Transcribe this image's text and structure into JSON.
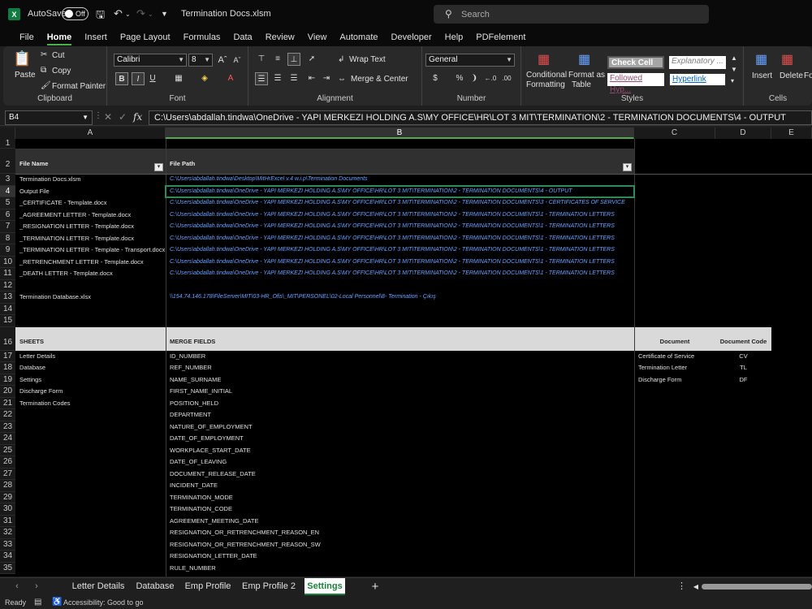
{
  "title_bar": {
    "autosave_label": "AutoSave",
    "autosave_state": "Off",
    "document_title": "Termination Docs.xlsm",
    "search_placeholder": "Search"
  },
  "menu": [
    "File",
    "Home",
    "Insert",
    "Page Layout",
    "Formulas",
    "Data",
    "Review",
    "View",
    "Automate",
    "Developer",
    "Help",
    "PDFelement"
  ],
  "ribbon": {
    "clipboard": {
      "paste": "Paste",
      "cut": "Cut",
      "copy": "Copy",
      "format_painter": "Format Painter",
      "label": "Clipboard"
    },
    "font": {
      "name": "Calibri",
      "size": "8",
      "label": "Font"
    },
    "alignment": {
      "wrap_text": "Wrap Text",
      "merge_center": "Merge & Center",
      "label": "Alignment"
    },
    "number": {
      "format": "General",
      "label": "Number"
    },
    "styles": {
      "conditional": "Conditional",
      "formatting": "Formatting",
      "format_as": "Format as",
      "table": "Table",
      "check_cell": "Check Cell",
      "explanatory": "Explanatory ...",
      "followed": "Followed Hyp...",
      "hyperlink": "Hyperlink",
      "label": "Styles"
    },
    "cells": {
      "insert": "Insert",
      "delete": "Delete",
      "format": "For",
      "label": "Cells"
    }
  },
  "formula_bar": {
    "name_box": "B4",
    "value": "C:\\Users\\abdallah.tindwa\\OneDrive - YAPI MERKEZI HOLDING A.S\\MY OFFICE\\HR\\LOT 3 MIT\\TERMINATION\\2 - TERMINATION DOCUMENTS\\4 - OUTPUT"
  },
  "columns": [
    "A",
    "B",
    "C",
    "D",
    "E"
  ],
  "rows": [
    "1",
    "2",
    "3",
    "4",
    "5",
    "6",
    "7",
    "8",
    "9",
    "10",
    "11",
    "12",
    "13",
    "14",
    "15",
    "16",
    "17",
    "18",
    "19",
    "20",
    "21",
    "22",
    "23",
    "24",
    "25",
    "26",
    "27",
    "28",
    "29",
    "30",
    "31",
    "32",
    "33",
    "34",
    "35"
  ],
  "table1": {
    "header_a": "File Name",
    "header_b": "File Path",
    "names": [
      "Termination Docs.xlsm",
      "Output File",
      "_CERTIFICATE - Template.docx",
      "_AGREEMENT LETTER - Template.docx",
      "_RESIGNATION LETTER - Template.docx",
      "_TERMINATION LETTER - Template.docx",
      "_TERMINATION LETTER - Template - Transport.docx",
      "_RETRENCHMENT LETTER - Template.docx",
      "_DEATH LETTER - Template.docx"
    ],
    "paths": [
      "C:\\Users\\abdallah.tindwa\\Desktop\\MitHrExcel v.4 w.i.p\\Termination Documents",
      "C:\\Users\\abdallah.tindwa\\OneDrive - YAPI MERKEZI HOLDING A.S\\MY OFFICE\\HR\\LOT 3 MIT\\TERMINATION\\2 - TERMINATION DOCUMENTS\\4 - OUTPUT",
      "C:\\Users\\abdallah.tindwa\\OneDrive - YAPI MERKEZI HOLDING A.S\\MY OFFICE\\HR\\LOT 3 MIT\\TERMINATION\\2 - TERMINATION DOCUMENTS\\3 - CERTIFICATES OF SERVICE",
      "C:\\Users\\abdallah.tindwa\\OneDrive - YAPI MERKEZI HOLDING A.S\\MY OFFICE\\HR\\LOT 3 MIT\\TERMINATION\\2 - TERMINATION DOCUMENTS\\1 - TERMINATION LETTERS",
      "C:\\Users\\abdallah.tindwa\\OneDrive - YAPI MERKEZI HOLDING A.S\\MY OFFICE\\HR\\LOT 3 MIT\\TERMINATION\\2 - TERMINATION DOCUMENTS\\1 - TERMINATION LETTERS",
      "C:\\Users\\abdallah.tindwa\\OneDrive - YAPI MERKEZI HOLDING A.S\\MY OFFICE\\HR\\LOT 3 MIT\\TERMINATION\\2 - TERMINATION DOCUMENTS\\1 - TERMINATION LETTERS",
      "C:\\Users\\abdallah.tindwa\\OneDrive - YAPI MERKEZI HOLDING A.S\\MY OFFICE\\HR\\LOT 3 MIT\\TERMINATION\\2 - TERMINATION DOCUMENTS\\1 - TERMINATION LETTERS",
      "C:\\Users\\abdallah.tindwa\\OneDrive - YAPI MERKEZI HOLDING A.S\\MY OFFICE\\HR\\LOT 3 MIT\\TERMINATION\\2 - TERMINATION DOCUMENTS\\1 - TERMINATION LETTERS",
      "C:\\Users\\abdallah.tindwa\\OneDrive - YAPI MERKEZI HOLDING A.S\\MY OFFICE\\HR\\LOT 3 MIT\\TERMINATION\\2 - TERMINATION DOCUMENTS\\1 - TERMINATION LETTERS"
    ],
    "db_name": "Termination Database.xlsx",
    "db_path": "\\\\154.74.146.178\\FileServer\\MIT\\03-HR_Ofis\\_MIT\\PERSONEL\\02-Local Personnel\\8- Termination - Çıkış"
  },
  "table2": {
    "header_sheets": "SHEETS",
    "header_fields": "MERGE FIELDS",
    "header_document": "Document",
    "header_code": "Document Code",
    "sheets": [
      "Letter Details",
      "Database",
      "Settings",
      "Discharge Form",
      "Termination Codes"
    ],
    "fields": [
      "ID_NUMBER",
      "REF_NUMBER",
      "NAME_SURNAME",
      "FIRST_NAME_INITIAL",
      "POSITION_HELD",
      "DEPARTMENT",
      "NATURE_OF_EMPLOYMENT",
      "DATE_OF_EMPLOYMENT",
      "WORKPLACE_START_DATE",
      "DATE_OF_LEAVING",
      "DOCUMENT_RELEASE_DATE",
      "INCIDENT_DATE",
      "TERMINATION_MODE",
      "TERMINATION_CODE",
      "AGREEMENT_MEETING_DATE",
      "RESIGNATION_OR_RETRENCHMENT_REASON_EN",
      "RESIGNATION_OR_RETRENCHMENT_REASON_SW",
      "RESIGNATION_LETTER_DATE",
      "RULE_NUMBER"
    ],
    "documents": [
      "Certificate of Service",
      "Termination Letter",
      "Discharge Form"
    ],
    "codes": [
      "CV",
      "TL",
      "DF"
    ]
  },
  "sheet_tabs": [
    "Letter Details",
    "Database",
    "Emp Profile",
    "Emp Profile 2",
    "Settings"
  ],
  "active_tab": "Settings",
  "status": {
    "ready": "Ready",
    "accessibility": "Accessibility: Good to go"
  },
  "colors": {
    "accent_green": "#1a7f3c",
    "link_blue": "#6aa2ff",
    "header_gray": "#d9d9d9"
  }
}
